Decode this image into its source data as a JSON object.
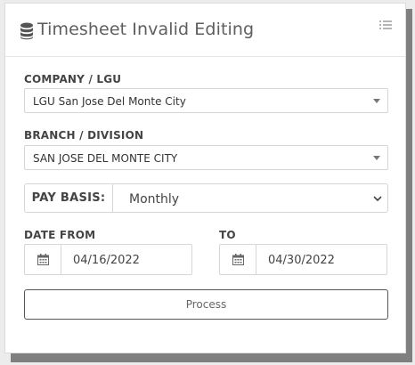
{
  "panel": {
    "title": "Timesheet Invalid Editing",
    "title_icon": "database-icon",
    "menu_icon": "list-icon"
  },
  "form": {
    "company": {
      "label": "COMPANY / LGU",
      "value": "LGU San Jose Del Monte City"
    },
    "branch": {
      "label": "BRANCH / DIVISION",
      "value": "SAN JOSE DEL MONTE CITY"
    },
    "pay_basis": {
      "label": "PAY BASIS:",
      "value": "Monthly"
    },
    "date_from": {
      "label": "DATE FROM",
      "value": "04/16/2022",
      "icon": "calendar-icon"
    },
    "date_to": {
      "label": "TO",
      "value": "04/30/2022",
      "icon": "calendar-icon"
    },
    "process_label": "Process"
  },
  "colors": {
    "background": "#ececec",
    "panel": "#ffffff",
    "border": "#d6d6d6",
    "shadow": "#7f7f7f"
  }
}
